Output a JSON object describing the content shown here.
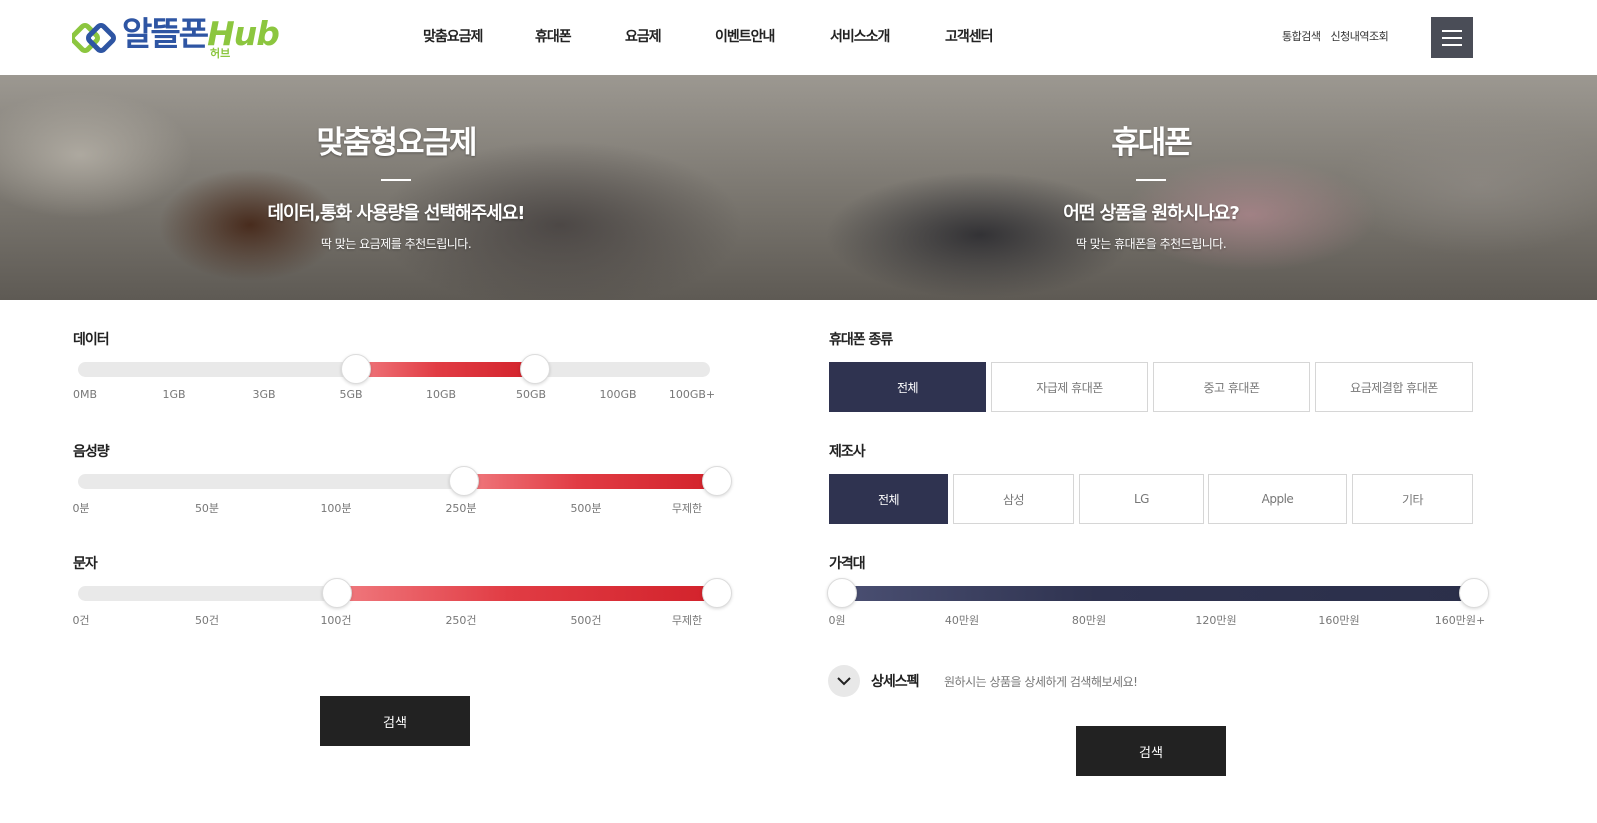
{
  "header": {
    "logo_text": "알뜰폰",
    "logo_hub": "Hub",
    "logo_sub": "허브",
    "nav": [
      "맞춤요금제",
      "휴대폰",
      "요금제",
      "이벤트안내",
      "서비스소개",
      "고객센터"
    ],
    "util_links": [
      "통합검색",
      "신청내역조회"
    ]
  },
  "hero": {
    "left": {
      "title": "맞춤형요금제",
      "subtitle": "데이터,통화 사용량을 선택해주세요!",
      "desc": "딱 맞는 요금제를 추천드립니다."
    },
    "right": {
      "title": "휴대폰",
      "subtitle": "어떤 상품을 원하시나요?",
      "desc": "딱 맞는 휴대폰을 추천드립니다."
    }
  },
  "plan_filters": {
    "data": {
      "label": "데이터",
      "ticks": [
        "0MB",
        "1GB",
        "3GB",
        "5GB",
        "10GB",
        "50GB",
        "100GB",
        "100GB+"
      ],
      "selected": [
        "5GB",
        "50GB"
      ]
    },
    "voice": {
      "label": "음성량",
      "ticks": [
        "0분",
        "50분",
        "100분",
        "250분",
        "500분",
        "무제한"
      ],
      "selected": [
        "250분",
        "무제한"
      ]
    },
    "sms": {
      "label": "문자",
      "ticks": [
        "0건",
        "50건",
        "100건",
        "250건",
        "500건",
        "무제한"
      ],
      "selected": [
        "100건",
        "무제한"
      ]
    },
    "search_label": "검색"
  },
  "phone_filters": {
    "type": {
      "label": "휴대폰 종류",
      "options": [
        "전체",
        "자급제 휴대폰",
        "중고 휴대폰",
        "요금제결합 휴대폰"
      ],
      "selected": "전체"
    },
    "maker": {
      "label": "제조사",
      "options": [
        "전체",
        "삼성",
        "LG",
        "Apple",
        "기타"
      ],
      "selected": "전체"
    },
    "price": {
      "label": "가격대",
      "ticks": [
        "0원",
        "40만원",
        "80만원",
        "120만원",
        "160만원",
        "160만원+"
      ],
      "selected": [
        "0원",
        "160만원+"
      ]
    },
    "detail": {
      "title": "상세스펙",
      "desc": "원하시는 상품을 상세하게 검색해보세요!"
    },
    "search_label": "검색"
  },
  "colors": {
    "brand_blue": "#2e55a3",
    "brand_green": "#8cc63f",
    "accent_red": "#d2222b",
    "navy": "#2f3350",
    "dark_button": "#222222"
  }
}
